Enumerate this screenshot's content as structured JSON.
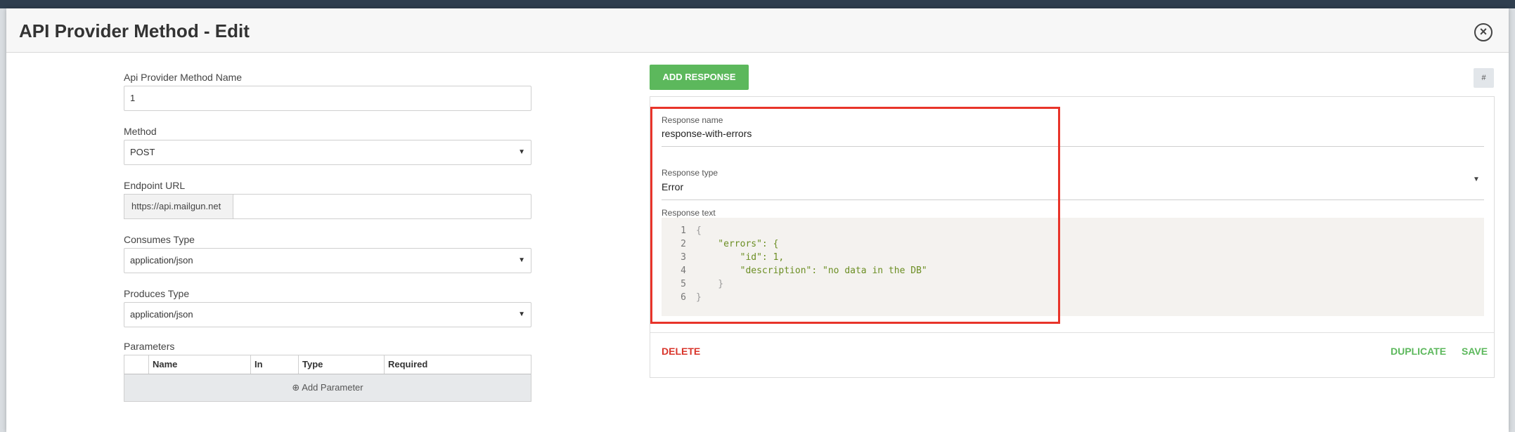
{
  "modal": {
    "title": "API Provider Method - Edit",
    "close_glyph": "×"
  },
  "form": {
    "name_label": "Api Provider Method Name",
    "name_value": "1",
    "method_label": "Method",
    "method_value": "POST",
    "endpoint_label": "Endpoint URL",
    "endpoint_prefix": "https://api.mailgun.net",
    "endpoint_value": "",
    "consumes_label": "Consumes Type",
    "consumes_value": "application/json",
    "produces_label": "Produces Type",
    "produces_value": "application/json",
    "params_label": "Parameters",
    "params_columns": [
      "",
      "Name",
      "In",
      "Type",
      "Required"
    ],
    "add_param_label": "Add Parameter"
  },
  "responses": {
    "add_label": "ADD RESPONSE",
    "hash_label": "#",
    "name_label": "Response name",
    "name_value": "response-with-errors",
    "type_label": "Response type",
    "type_value": "Error",
    "text_label": "Response text",
    "code_lines": [
      {
        "n": "1",
        "t": "{"
      },
      {
        "n": "2",
        "t": "    \"errors\": {"
      },
      {
        "n": "3",
        "t": "        \"id\": 1,"
      },
      {
        "n": "4",
        "t": "        \"description\": \"no data in the DB\""
      },
      {
        "n": "5",
        "t": "    }"
      },
      {
        "n": "6",
        "t": "}"
      }
    ],
    "delete_label": "DELETE",
    "duplicate_label": "DUPLICATE",
    "save_label": "SAVE"
  },
  "colors": {
    "accent_green": "#5cb85c",
    "danger_red": "#d9352b",
    "highlight_red": "#e8342a"
  }
}
